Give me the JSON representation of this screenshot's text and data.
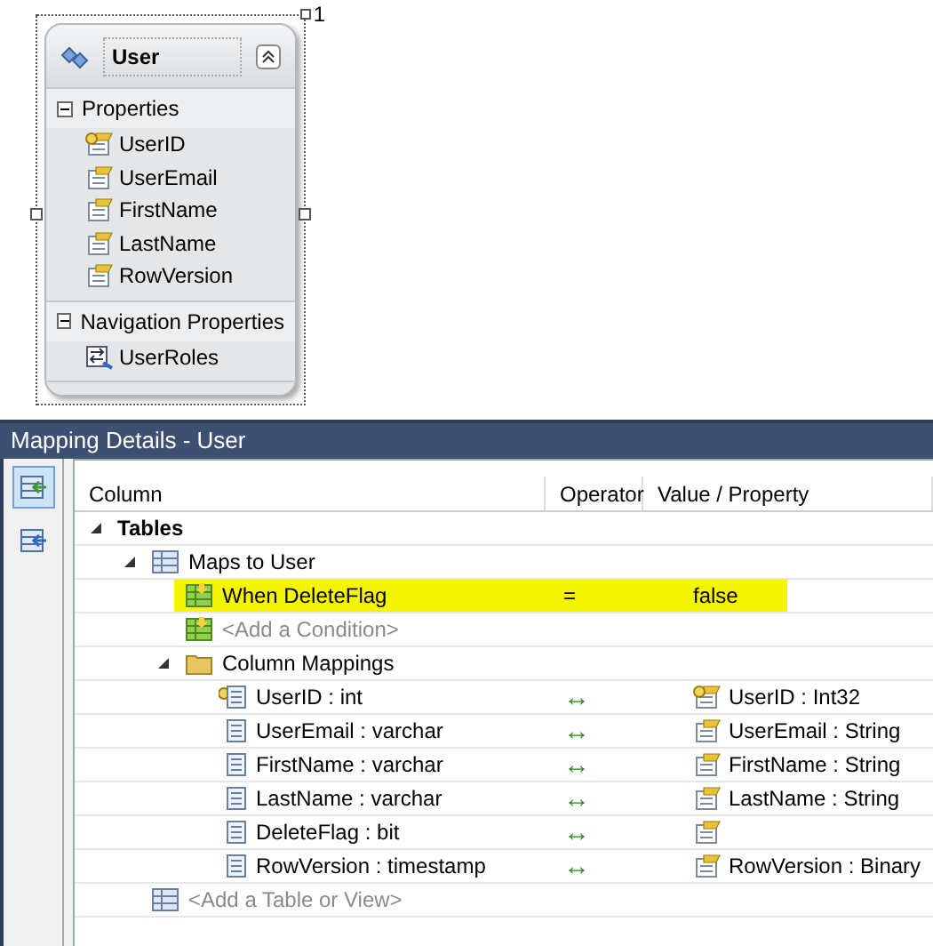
{
  "entity": {
    "title": "User",
    "multiplicity": "1",
    "collapsed": false,
    "sections": [
      {
        "title": "Properties",
        "expanded": true,
        "items": [
          {
            "label": "UserID",
            "kind": "key"
          },
          {
            "label": "UserEmail",
            "kind": "property"
          },
          {
            "label": "FirstName",
            "kind": "property"
          },
          {
            "label": "LastName",
            "kind": "property"
          },
          {
            "label": "RowVersion",
            "kind": "property"
          }
        ]
      },
      {
        "title": "Navigation Properties",
        "expanded": true,
        "items": [
          {
            "label": "UserRoles",
            "kind": "navigation"
          }
        ]
      }
    ]
  },
  "mapping": {
    "title": "Mapping Details - User",
    "toolbar": [
      {
        "kind": "tables",
        "selected": true
      },
      {
        "kind": "functions",
        "selected": false
      }
    ],
    "columns": [
      "Column",
      "Operator",
      "Value / Property"
    ],
    "tree": [
      {
        "kind": "group",
        "label": "Tables",
        "expanded": true,
        "children": [
          {
            "kind": "table",
            "label": "Maps to User",
            "expanded": true,
            "children": [
              {
                "kind": "condition",
                "label": "When DeleteFlag",
                "operator": "=",
                "value": "false",
                "highlighted": true
              },
              {
                "kind": "add-condition",
                "label": "<Add a Condition>"
              },
              {
                "kind": "folder",
                "label": "Column Mappings",
                "expanded": true,
                "children": [
                  {
                    "kind": "column",
                    "key": true,
                    "label": "UserID : int",
                    "operator": "↔",
                    "value": "UserID : Int32"
                  },
                  {
                    "kind": "column",
                    "key": false,
                    "label": "UserEmail : varchar",
                    "operator": "↔",
                    "value": "UserEmail : String"
                  },
                  {
                    "kind": "column",
                    "key": false,
                    "label": "FirstName : varchar",
                    "operator": "↔",
                    "value": "FirstName : String"
                  },
                  {
                    "kind": "column",
                    "key": false,
                    "label": "LastName : varchar",
                    "operator": "↔",
                    "value": "LastName : String"
                  },
                  {
                    "kind": "column",
                    "key": false,
                    "label": "DeleteFlag : bit",
                    "operator": "↔"
                  },
                  {
                    "kind": "column",
                    "key": false,
                    "label": "RowVersion : timestamp",
                    "operator": "↔",
                    "value": "RowVersion : Binary"
                  }
                ]
              }
            ]
          },
          {
            "kind": "add-table",
            "label": "<Add a Table or View>"
          }
        ]
      }
    ]
  }
}
